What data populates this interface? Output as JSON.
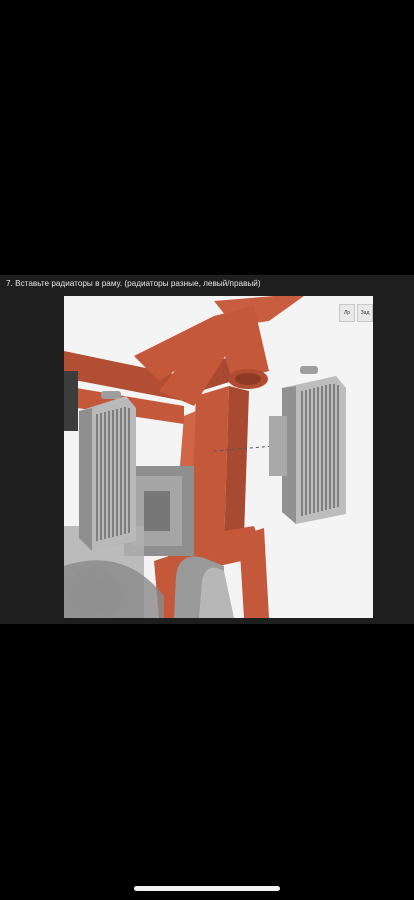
{
  "caption": "7. Вставьте радиаторы в раму. (радиаторы разные, левый/правый)",
  "view_cube": {
    "left_face": "Лр",
    "right_face": "Зад"
  },
  "colors": {
    "frame": "#c4583a",
    "radiator": "#bdbdbd",
    "background": "#f4f4f4",
    "band": "#1e1e1e"
  }
}
